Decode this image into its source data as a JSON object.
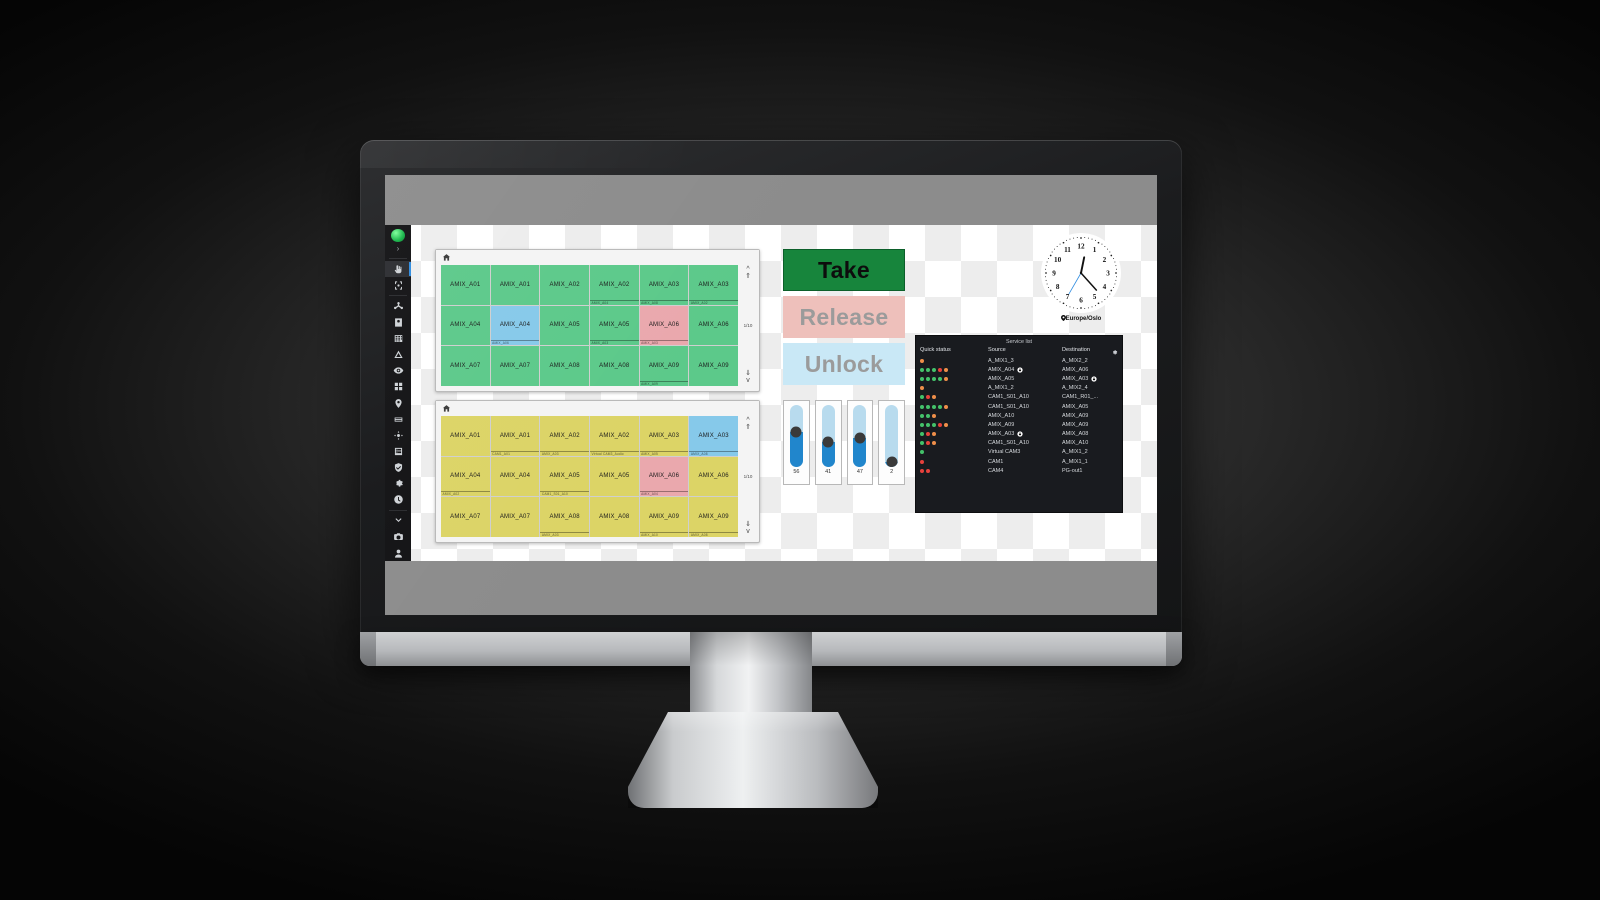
{
  "app": {
    "background_pattern": "checkerboard",
    "chrome_color": "#8c8c8c"
  },
  "sidebar": {
    "logo_name": "app-logo",
    "expand_caret": "›",
    "items": [
      {
        "name": "sidebar-item-pointer",
        "icon": "hand-pointer-icon",
        "active": true
      },
      {
        "name": "sidebar-item-crosshair",
        "icon": "crosshair-icon",
        "active": false
      },
      {
        "name": "sidebar-item-topology",
        "icon": "network-topology-icon",
        "active": false
      },
      {
        "name": "sidebar-item-user",
        "icon": "user-badge-icon",
        "active": false
      },
      {
        "name": "sidebar-item-matrix",
        "icon": "grid-matrix-icon",
        "active": false
      },
      {
        "name": "sidebar-item-alerts",
        "icon": "warning-triangle-icon",
        "active": false
      },
      {
        "name": "sidebar-item-monitor",
        "icon": "eye-icon",
        "active": false
      },
      {
        "name": "sidebar-item-panels",
        "icon": "dashboard-squares-icon",
        "active": false
      },
      {
        "name": "sidebar-item-location",
        "icon": "map-pin-icon",
        "active": false
      },
      {
        "name": "sidebar-item-list",
        "icon": "list-rows-icon",
        "active": false
      },
      {
        "name": "sidebar-item-nodes",
        "icon": "nodes-icon",
        "active": false
      },
      {
        "name": "sidebar-item-devices",
        "icon": "device-rack-icon",
        "active": false
      },
      {
        "name": "sidebar-item-security",
        "icon": "shield-check-icon",
        "active": false
      },
      {
        "name": "sidebar-item-settings",
        "icon": "gear-icon",
        "active": false
      },
      {
        "name": "sidebar-item-history",
        "icon": "clock-history-icon",
        "active": false
      },
      {
        "name": "sidebar-item-more",
        "icon": "chevron-down-icon",
        "active": false
      },
      {
        "name": "sidebar-item-snapshot",
        "icon": "camera-icon",
        "active": false
      },
      {
        "name": "sidebar-item-account",
        "icon": "person-icon",
        "active": false
      }
    ]
  },
  "panels": [
    {
      "id": "panel-green",
      "home_icon": "home-icon",
      "page_label": "1/10",
      "scroll": {
        "up": "∧",
        "page_up": "»",
        "page_down": "»",
        "down": "∨"
      },
      "cells": [
        {
          "label": "AMIX_A01",
          "sub": "",
          "color": "green"
        },
        {
          "label": "AMIX_A01",
          "sub": "",
          "color": "green"
        },
        {
          "label": "AMIX_A02",
          "sub": "",
          "color": "green"
        },
        {
          "label": "AMIX_A02",
          "sub": "AMIX_A04",
          "color": "green"
        },
        {
          "label": "AMIX_A03",
          "sub": "AMIX_A08",
          "color": "green"
        },
        {
          "label": "AMIX_A03",
          "sub": "AMIX_A02",
          "color": "green"
        },
        {
          "label": "AMIX_A04",
          "sub": "",
          "color": "green"
        },
        {
          "label": "AMIX_A04",
          "sub": "AMIX_A06",
          "color": "blue"
        },
        {
          "label": "AMIX_A05",
          "sub": "",
          "color": "green"
        },
        {
          "label": "AMIX_A05",
          "sub": "AMIX_A03",
          "color": "green"
        },
        {
          "label": "AMIX_A06",
          "sub": "AMIX_A03",
          "color": "pink"
        },
        {
          "label": "AMIX_A06",
          "sub": "",
          "color": "green"
        },
        {
          "label": "AMIX_A07",
          "sub": "",
          "color": "green"
        },
        {
          "label": "AMIX_A07",
          "sub": "",
          "color": "green"
        },
        {
          "label": "AMIX_A08",
          "sub": "",
          "color": "green"
        },
        {
          "label": "AMIX_A08",
          "sub": "",
          "color": "green"
        },
        {
          "label": "AMIX_A09",
          "sub": "AMIX_A09",
          "color": "green"
        },
        {
          "label": "AMIX_A09",
          "sub": "",
          "color": "green"
        }
      ]
    },
    {
      "id": "panel-yellow",
      "home_icon": "home-icon",
      "page_label": "1/10",
      "scroll": {
        "up": "∧",
        "page_up": "»",
        "page_down": "»",
        "down": "∨"
      },
      "cells": [
        {
          "label": "AMIX_A01",
          "sub": "",
          "color": "yellow"
        },
        {
          "label": "AMIX_A01",
          "sub": "CAM1_A01",
          "color": "yellow"
        },
        {
          "label": "AMIX_A02",
          "sub": "AMIX_A03",
          "color": "yellow"
        },
        {
          "label": "AMIX_A02",
          "sub": "Virtual CAM3_Audio",
          "color": "yellow"
        },
        {
          "label": "AMIX_A03",
          "sub": "AMIX_A05",
          "color": "yellow"
        },
        {
          "label": "AMIX_A03",
          "sub": "AMIX_A08",
          "color": "blue"
        },
        {
          "label": "AMIX_A04",
          "sub": "AMIX_A02",
          "color": "yellow"
        },
        {
          "label": "AMIX_A04",
          "sub": "",
          "color": "yellow"
        },
        {
          "label": "AMIX_A05",
          "sub": "CAM1_S01_A10",
          "color": "yellow"
        },
        {
          "label": "AMIX_A05",
          "sub": "",
          "color": "yellow"
        },
        {
          "label": "AMIX_A06",
          "sub": "AMIX_A04",
          "color": "pink"
        },
        {
          "label": "AMIX_A06",
          "sub": "",
          "color": "yellow"
        },
        {
          "label": "AMIX_A07",
          "sub": "",
          "color": "yellow"
        },
        {
          "label": "AMIX_A07",
          "sub": "",
          "color": "yellow"
        },
        {
          "label": "AMIX_A08",
          "sub": "AMIX_A03",
          "color": "yellow"
        },
        {
          "label": "AMIX_A08",
          "sub": "",
          "color": "yellow"
        },
        {
          "label": "AMIX_A09",
          "sub": "AMIX_A10",
          "color": "yellow"
        },
        {
          "label": "AMIX_A09",
          "sub": "AMIX_A08",
          "color": "yellow"
        }
      ]
    }
  ],
  "actions": {
    "take": "Take",
    "release": "Release",
    "unlock": "Unlock",
    "take_color": "#17853c",
    "release_color": "#eec0bb",
    "unlock_color": "#c9e8f6"
  },
  "faders": [
    {
      "name": "fader-1",
      "value": "56",
      "percent": 56
    },
    {
      "name": "fader-2",
      "value": "41",
      "percent": 41
    },
    {
      "name": "fader-3",
      "value": "47",
      "percent": 47
    },
    {
      "name": "fader-4",
      "value": "2",
      "percent": 8
    }
  ],
  "clock": {
    "timezone": "Europe/Oslo",
    "pin_icon": "map-pin-icon",
    "hour": 12,
    "minute": 23,
    "second": 35,
    "numerals": [
      "12",
      "1",
      "2",
      "3",
      "4",
      "5",
      "6",
      "7",
      "8",
      "9",
      "10",
      "11"
    ]
  },
  "service_list": {
    "title": "Service list",
    "gear_icon": "gear-icon",
    "columns": [
      "Quick status",
      "Source",
      "Destination"
    ],
    "rows": [
      {
        "dots": [
          "orange"
        ],
        "source": "A_MIX1_3",
        "source_lock": false,
        "destination": "A_MIX2_2",
        "destination_lock": false
      },
      {
        "dots": [
          "green",
          "green",
          "green",
          "red",
          "orange"
        ],
        "source": "AMIX_A04",
        "source_lock": true,
        "destination": "AMIX_A06",
        "destination_lock": false
      },
      {
        "dots": [
          "green",
          "green",
          "green",
          "green",
          "orange"
        ],
        "source": "AMIX_A05",
        "source_lock": false,
        "destination": "AMIX_A03",
        "destination_lock": true
      },
      {
        "dots": [
          "orange"
        ],
        "source": "A_MIX1_2",
        "source_lock": false,
        "destination": "A_MIX2_4",
        "destination_lock": false
      },
      {
        "dots": [
          "green",
          "red",
          "orange"
        ],
        "source": "CAM1_S01_A10",
        "source_lock": false,
        "destination": "CAM1_R01_...",
        "destination_lock": false
      },
      {
        "dots": [
          "green",
          "green",
          "green",
          "green",
          "orange"
        ],
        "source": "CAM1_S01_A10",
        "source_lock": false,
        "destination": "AMIX_A05",
        "destination_lock": false
      },
      {
        "dots": [
          "green",
          "green",
          "orange"
        ],
        "source": "AMIX_A10",
        "source_lock": false,
        "destination": "AMIX_A09",
        "destination_lock": false
      },
      {
        "dots": [
          "green",
          "green",
          "green",
          "red",
          "orange"
        ],
        "source": "AMIX_A09",
        "source_lock": false,
        "destination": "AMIX_A09",
        "destination_lock": false
      },
      {
        "dots": [
          "green",
          "red",
          "orange"
        ],
        "source": "AMIX_A03",
        "source_lock": true,
        "destination": "AMIX_A08",
        "destination_lock": false
      },
      {
        "dots": [
          "green",
          "red",
          "orange"
        ],
        "source": "CAM1_S01_A10",
        "source_lock": false,
        "destination": "AMIX_A10",
        "destination_lock": false
      },
      {
        "dots": [
          "green"
        ],
        "source": "Virtual CAM3",
        "source_lock": false,
        "destination": "A_MIX1_2",
        "destination_lock": false
      },
      {
        "dots": [
          "red"
        ],
        "source": "CAM1",
        "source_lock": false,
        "destination": "A_MIX1_1",
        "destination_lock": false
      },
      {
        "dots": [
          "red",
          "red"
        ],
        "source": "CAM4",
        "source_lock": false,
        "destination": "PG-out1",
        "destination_lock": false
      }
    ],
    "dot_colors": {
      "green": "#44c26a",
      "red": "#e8413c",
      "orange": "#ef8f4a"
    }
  }
}
